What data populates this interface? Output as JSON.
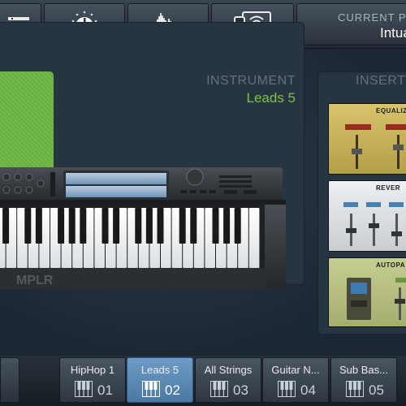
{
  "toolbar": {
    "buttons": [
      {
        "icon": "mixer-list-icon"
      },
      {
        "icon": "knob-icon"
      },
      {
        "icon": "waveform-icon"
      },
      {
        "icon": "devices-wifi-icon"
      }
    ],
    "current_preset_label": "CURRENT P",
    "current_preset_value": "Intua"
  },
  "instrument": {
    "title": "INSTRUMENT",
    "name": "Leads 5",
    "keyboard_brand": "MPLR"
  },
  "inserts": {
    "title": "INSERT",
    "effects": [
      {
        "name": "EQUALIZ",
        "color": "#c9b45d"
      },
      {
        "name": "REVER",
        "color": "#dfe3e6"
      },
      {
        "name": "AUTOPA",
        "color": "#b9c287"
      }
    ]
  },
  "presets": [
    {
      "name": "HipHop 1",
      "number": "01",
      "active": false
    },
    {
      "name": "Leads 5",
      "number": "02",
      "active": true
    },
    {
      "name": "All Strings",
      "number": "03",
      "active": false
    },
    {
      "name": "Guitar N...",
      "number": "04",
      "active": false
    },
    {
      "name": "Sub Bas...",
      "number": "05",
      "active": false
    }
  ],
  "colors": {
    "accent_green": "#7dc243",
    "active_preset": "#5a88b6"
  }
}
